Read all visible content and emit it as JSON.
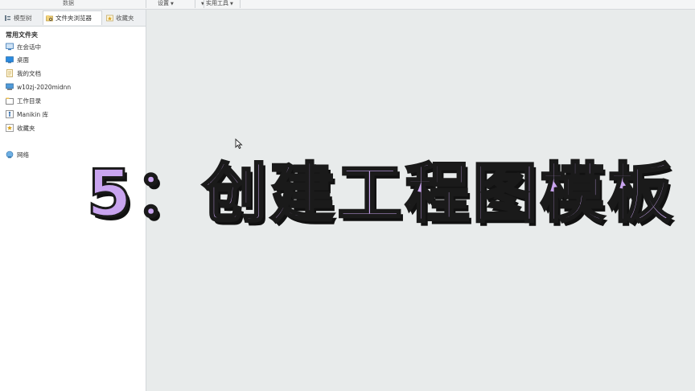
{
  "ribbon": {
    "group_label": "数据",
    "dropdowns": [
      {
        "label": "设置"
      },
      {
        "label": "实用工具"
      }
    ]
  },
  "navigator": {
    "tabs": [
      {
        "label": "模型树"
      },
      {
        "label": "文件夹浏览器"
      },
      {
        "label": "收藏夹"
      }
    ],
    "section_title": "常用文件夹",
    "items": [
      {
        "label": "在会话中",
        "icon": "session-icon"
      },
      {
        "label": "桌面",
        "icon": "desktop-icon"
      },
      {
        "label": "我的文档",
        "icon": "documents-icon"
      },
      {
        "label": "w10zj-2020midnn",
        "icon": "computer-icon"
      },
      {
        "label": "工作目录",
        "icon": "working-directory-icon"
      },
      {
        "label": "Manikin 库",
        "icon": "manikin-library-icon"
      },
      {
        "label": "收藏夹",
        "icon": "favorites-icon"
      }
    ],
    "network": {
      "label": "网络",
      "icon": "network-icon"
    }
  },
  "overlay": {
    "caption": "5：创建工程图模板",
    "color": "#c9a4ef"
  }
}
